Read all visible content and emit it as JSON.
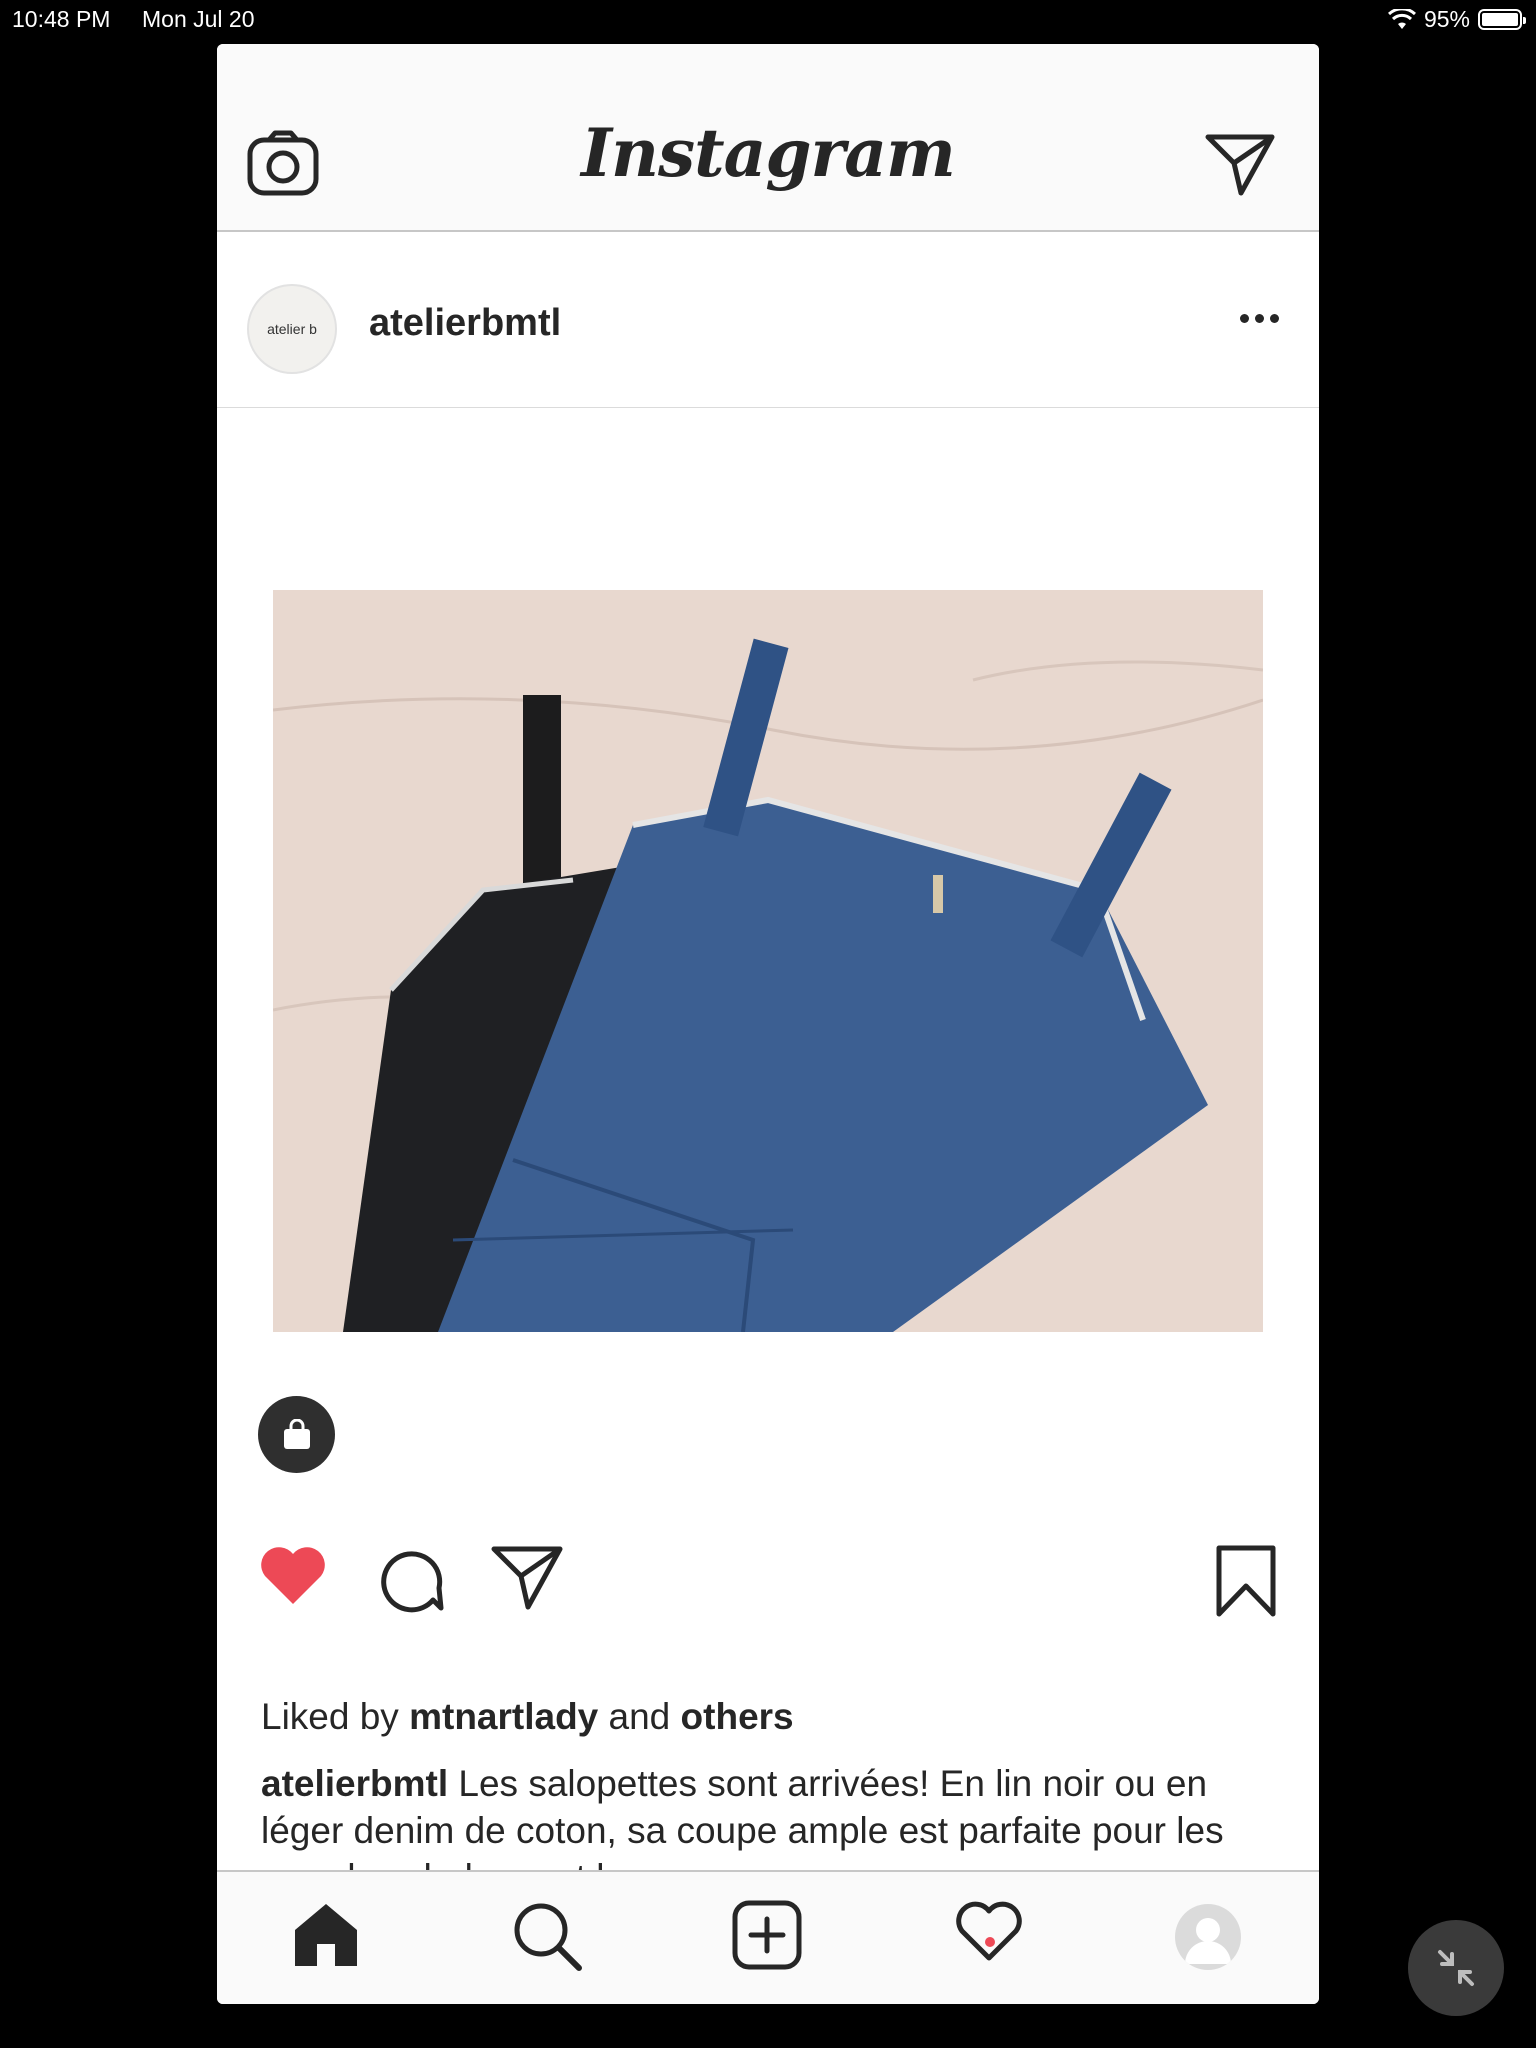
{
  "status_bar": {
    "time": "10:48 PM",
    "date": "Mon Jul 20",
    "battery": "95%",
    "battery_level": 0.95
  },
  "header": {
    "title": "Instagram",
    "camera_icon": "camera-icon",
    "direct_icon": "paper-plane-icon"
  },
  "post": {
    "username": "atelierbmtl",
    "avatar_text": "atelier b",
    "photo_description_icon": "photo",
    "likes": {
      "prefix": "Liked by",
      "user": "mtnartlady",
      "joiner": "and",
      "others": "others"
    },
    "caption": {
      "username": "atelierbmtl",
      "text": "Les salopettes sont arrivées! En lin noir ou en léger denim de coton, sa coupe ample est parfaite pour les grandes chaleurs et les"
    }
  },
  "tab_bar": {
    "items": [
      "home-icon",
      "search-icon",
      "new-post-icon",
      "activity-heart-icon",
      "profile-avatar"
    ]
  },
  "colors": {
    "like_red": "#ed4956",
    "text": "#262626",
    "bar_bg": "#fafafa"
  }
}
